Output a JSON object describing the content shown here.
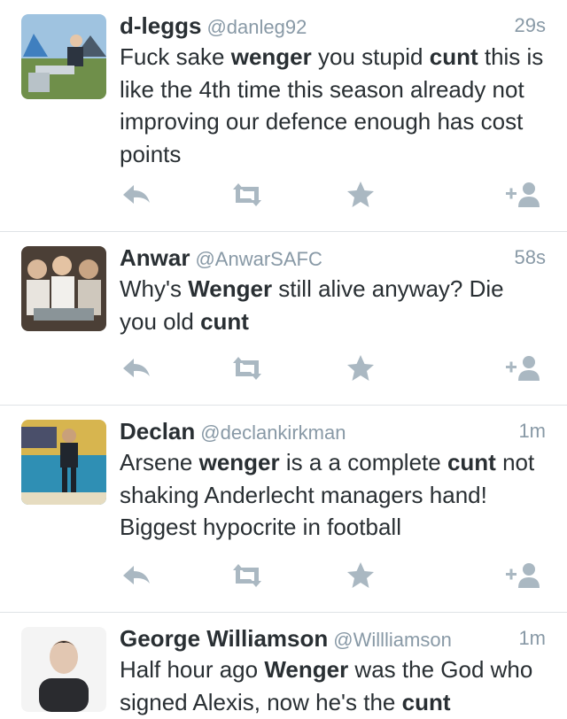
{
  "tweets": [
    {
      "name": "d-leggs",
      "handle": "@danleg92",
      "time": "29s",
      "text_segments": [
        {
          "t": "Fuck sake ",
          "b": false
        },
        {
          "t": "wenger",
          "b": true
        },
        {
          "t": " you stupid ",
          "b": false
        },
        {
          "t": "cunt",
          "b": true
        },
        {
          "t": " this is like the 4th time this season already not improving our defence enough has cost points",
          "b": false
        }
      ]
    },
    {
      "name": "Anwar",
      "handle": "@AnwarSAFC",
      "time": "58s",
      "text_segments": [
        {
          "t": "Why's ",
          "b": false
        },
        {
          "t": "Wenger",
          "b": true
        },
        {
          "t": " still alive anyway? Die you old ",
          "b": false
        },
        {
          "t": "cunt",
          "b": true
        }
      ]
    },
    {
      "name": "Declan",
      "handle": "@declankirkman",
      "time": "1m",
      "text_segments": [
        {
          "t": "Arsene ",
          "b": false
        },
        {
          "t": "wenger",
          "b": true
        },
        {
          "t": " is a a complete ",
          "b": false
        },
        {
          "t": "cunt",
          "b": true
        },
        {
          "t": " not shaking Anderlecht managers hand! Biggest hypocrite in football",
          "b": false
        }
      ]
    },
    {
      "name": "George Williamson",
      "handle": "@Willliamson",
      "time": "1m",
      "text_segments": [
        {
          "t": "Half hour ago ",
          "b": false
        },
        {
          "t": "Wenger",
          "b": true
        },
        {
          "t": " was the God who signed Alexis, now he's the ",
          "b": false
        },
        {
          "t": "cunt",
          "b": true
        }
      ]
    }
  ],
  "action_icons": [
    "reply-icon",
    "retweet-icon",
    "favorite-icon",
    "follow-icon"
  ],
  "colors": {
    "icon": "#aab8c2",
    "meta": "#8899a6",
    "text": "#292f33",
    "divider": "#dfe3e6"
  }
}
